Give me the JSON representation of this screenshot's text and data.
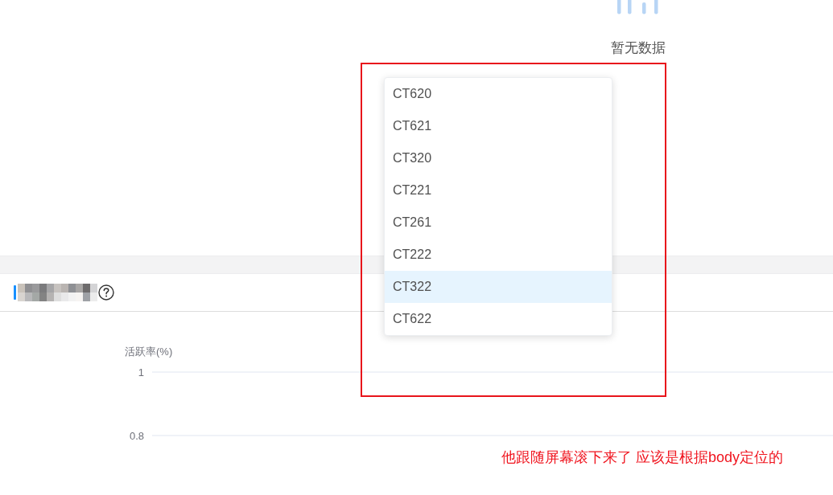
{
  "empty_state": {
    "message": "暂无数据"
  },
  "panel": {
    "chart": {
      "y_axis_title": "活跃率(%)",
      "y_tick_labels": [
        "1",
        "0.8"
      ]
    }
  },
  "dropdown": {
    "options": [
      {
        "label": "CT620",
        "highlighted": false
      },
      {
        "label": "CT621",
        "highlighted": false
      },
      {
        "label": "CT320",
        "highlighted": false
      },
      {
        "label": "CT221",
        "highlighted": false
      },
      {
        "label": "CT261",
        "highlighted": false
      },
      {
        "label": "CT222",
        "highlighted": false
      },
      {
        "label": "CT322",
        "highlighted": true
      },
      {
        "label": "CT622",
        "highlighted": false
      }
    ]
  },
  "annotation": {
    "note": "他跟随屏幕滚下来了 应该是根据body定位的"
  }
}
